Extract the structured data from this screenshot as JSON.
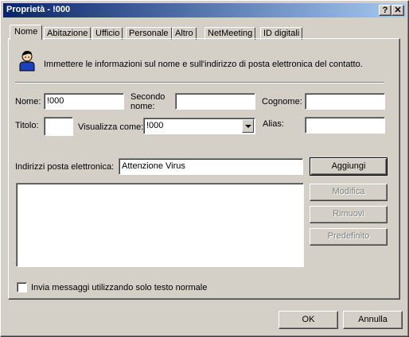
{
  "window": {
    "title": "Proprietà - !000",
    "help_label": "?",
    "close_label": "✕"
  },
  "tabs": [
    {
      "label": "Nome"
    },
    {
      "label": "Abitazione"
    },
    {
      "label": "Ufficio"
    },
    {
      "label": "Personale"
    },
    {
      "label": "Altro"
    },
    {
      "label": "NetMeeting"
    },
    {
      "label": "ID digitali"
    }
  ],
  "intro": {
    "text": "Immettere le informazioni sul nome e sull'indirizzo di posta elettronica del contatto.",
    "icon": "person-icon"
  },
  "form": {
    "nome_label": "Nome:",
    "nome_value": "!000",
    "secondo_nome_label_1": "Secondo",
    "secondo_nome_label_2": "nome:",
    "secondo_nome_value": "",
    "cognome_label": "Cognome:",
    "cognome_value": "",
    "titolo_label": "Titolo:",
    "titolo_value": "",
    "visualizza_label": "Visualizza come:",
    "visualizza_value": "!000",
    "alias_label": "Alias:",
    "alias_value": ""
  },
  "email": {
    "label": "Indirizzi posta elettronica:",
    "value": "Attenzione Virus",
    "list": [],
    "add_button": "Aggiungi",
    "edit_button": "Modifica",
    "remove_button": "Rimuovi",
    "default_button": "Predefinito"
  },
  "plain_text_checkbox": {
    "label": "Invia messaggi utilizzando solo testo normale",
    "checked": false
  },
  "footer": {
    "ok_label": "OK",
    "cancel_label": "Annulla"
  }
}
